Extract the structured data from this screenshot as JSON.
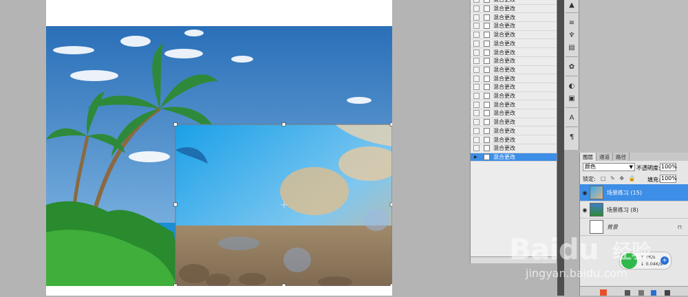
{
  "history_panel": {
    "items": [
      {
        "label": "混合更改"
      },
      {
        "label": "混合更改"
      },
      {
        "label": "混合更改"
      },
      {
        "label": "混合更改"
      },
      {
        "label": "混合更改"
      },
      {
        "label": "混合更改"
      },
      {
        "label": "混合更改"
      },
      {
        "label": "混合更改"
      },
      {
        "label": "混合更改"
      },
      {
        "label": "混合更改"
      },
      {
        "label": "混合更改"
      },
      {
        "label": "混合更改"
      },
      {
        "label": "混合更改"
      },
      {
        "label": "混合更改"
      },
      {
        "label": "混合更改"
      },
      {
        "label": "混合更改"
      },
      {
        "label": "混合更改"
      },
      {
        "label": "混合更改"
      }
    ],
    "active_label": "混合更改"
  },
  "layers_panel": {
    "tabs": [
      {
        "label": "图层"
      },
      {
        "label": "通道"
      },
      {
        "label": "路径"
      }
    ],
    "blend_mode": "颜色",
    "opacity_label": "不透明度:",
    "opacity_value": "100%",
    "lock_label": "锁定:",
    "fill_label": "填充:",
    "fill_value": "100%",
    "layers": [
      {
        "name": "场景练习 (15)",
        "selected": true
      },
      {
        "name": "场景练习 (8)",
        "selected": false
      },
      {
        "name": "背景",
        "selected": false,
        "locked": true
      }
    ]
  },
  "net_widget": {
    "up": "0K/s",
    "down": "0.04K/s"
  },
  "watermark": {
    "brand": "Baidu",
    "cn": "经验",
    "url": "jingyan.baidu.com"
  },
  "colors": {
    "accent": "#3d8ee6",
    "sky_top": "#2a6fb8",
    "sand": "#9c8668",
    "palm": "#2e8a3a"
  },
  "icons": {
    "eye": "eye-icon",
    "lock": "lock-icon",
    "history_state": "document-icon"
  }
}
